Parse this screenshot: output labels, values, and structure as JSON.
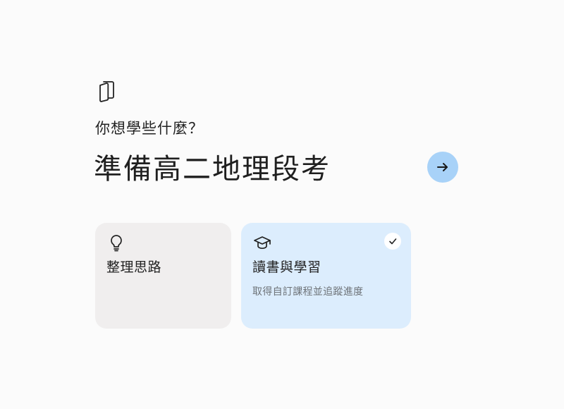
{
  "app": {
    "icon": "document-icon"
  },
  "prompt": {
    "question": "你想學些什麼？",
    "input_value": "準備高二地理段考",
    "submit_icon": "arrow-right-icon",
    "submit_color": "#a8d2f8"
  },
  "options": [
    {
      "icon": "lightbulb-icon",
      "title": "整理思路",
      "selected": false,
      "color": "#f0eeee"
    },
    {
      "icon": "graduation-cap-icon",
      "title": "讀書與學習",
      "description": "取得自訂課程並追蹤進度",
      "selected": true,
      "check_icon": "checkmark-icon",
      "color": "#dcedfd"
    }
  ]
}
